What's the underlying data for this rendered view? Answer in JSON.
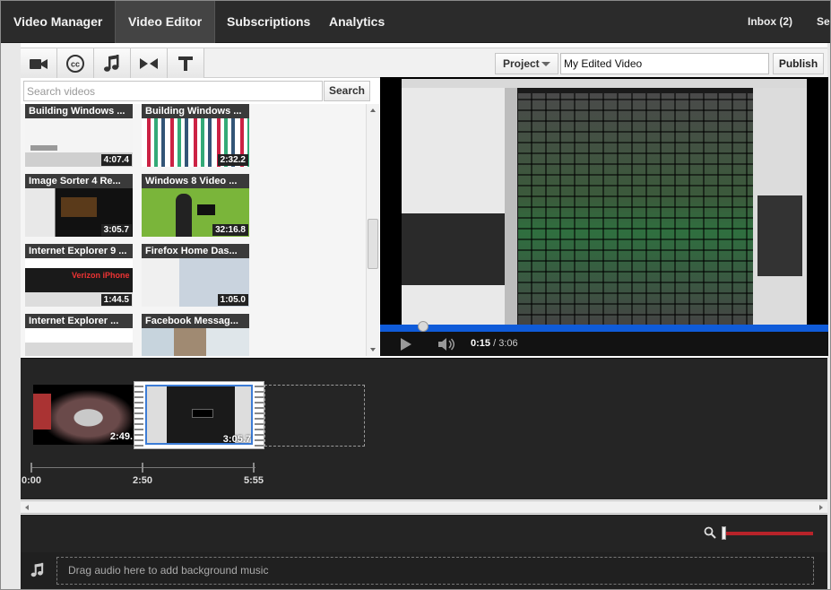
{
  "nav": {
    "tabs": [
      {
        "label": "Video Manager"
      },
      {
        "label": "Video Editor"
      },
      {
        "label": "Subscriptions"
      },
      {
        "label": "Analytics"
      }
    ],
    "inbox": "Inbox (2)",
    "settings_partial": "Se"
  },
  "toolbar": {
    "tools": [
      "video-camera-icon",
      "closed-caption-icon",
      "music-note-icon",
      "transitions-icon",
      "text-icon"
    ],
    "project_label": "Project",
    "title_value": "My Edited Video",
    "publish_label": "Publish"
  },
  "search": {
    "placeholder": "Search videos",
    "button": "Search"
  },
  "library": {
    "videos": [
      {
        "title": "Building Windows ...",
        "duration": "4:07.4"
      },
      {
        "title": "Building Windows ...",
        "duration": "2:32.2"
      },
      {
        "title": "Image Sorter 4 Re...",
        "duration": "3:05.7"
      },
      {
        "title": "Windows 8 Video ...",
        "duration": "32:16.8"
      },
      {
        "title": "Internet Explorer 9 ...",
        "duration": "1:44.5"
      },
      {
        "title": "Firefox Home Das...",
        "duration": "1:05.0"
      },
      {
        "title": "Internet Explorer ...",
        "duration": ""
      },
      {
        "title": "Facebook Messag...",
        "duration": ""
      }
    ],
    "thumb_overlay_text": "Verizon iPhone"
  },
  "player": {
    "current_time": "0:15",
    "separator": " / ",
    "total_time": "3:06",
    "progress": 0.08,
    "progress_color": "#0f5bd9"
  },
  "timeline": {
    "clips": [
      {
        "duration": "2:49."
      },
      {
        "duration": "3:05.7"
      }
    ],
    "ticks": [
      "0:00",
      "2:50",
      "5:55"
    ]
  },
  "zoom": {
    "level": 0.02,
    "track_color": "#b8232a"
  },
  "audio": {
    "drop_text": "Drag audio here to add background music"
  }
}
